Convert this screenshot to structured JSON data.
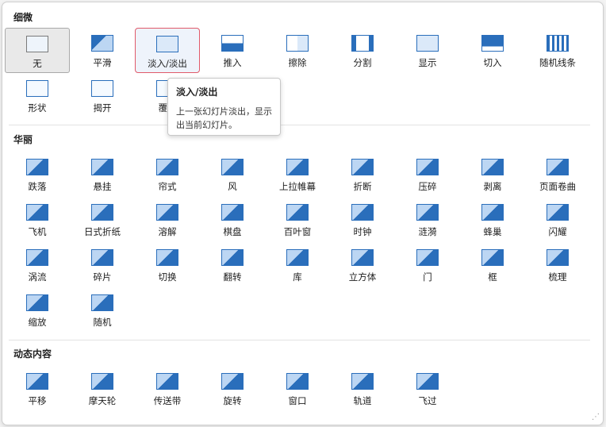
{
  "sections": [
    {
      "title": "细微",
      "items": [
        {
          "label": "无",
          "icon": "none-icon"
        },
        {
          "label": "平滑",
          "icon": "smooth-icon"
        },
        {
          "label": "淡入/淡出",
          "icon": "fade-icon"
        },
        {
          "label": "推入",
          "icon": "push-icon"
        },
        {
          "label": "擦除",
          "icon": "wipe-icon"
        },
        {
          "label": "分割",
          "icon": "split-icon"
        },
        {
          "label": "显示",
          "icon": "reveal-icon"
        },
        {
          "label": "切入",
          "icon": "cut-icon"
        },
        {
          "label": "随机线条",
          "icon": "random-bars-icon"
        },
        {
          "label": "形状",
          "icon": "shape-icon"
        },
        {
          "label": "揭开",
          "icon": "uncover-icon"
        },
        {
          "label": "覆盖",
          "icon": "cover-icon"
        }
      ]
    },
    {
      "title": "华丽",
      "items": [
        {
          "label": "跌落",
          "icon": "fall-over-icon"
        },
        {
          "label": "悬挂",
          "icon": "drape-icon"
        },
        {
          "label": "帘式",
          "icon": "curtains-icon"
        },
        {
          "label": "风",
          "icon": "wind-icon"
        },
        {
          "label": "上拉帷幕",
          "icon": "prestige-icon"
        },
        {
          "label": "折断",
          "icon": "fracture-icon"
        },
        {
          "label": "压碎",
          "icon": "crush-icon"
        },
        {
          "label": "剥离",
          "icon": "peel-off-icon"
        },
        {
          "label": "页面卷曲",
          "icon": "page-curl-icon"
        },
        {
          "label": "飞机",
          "icon": "airplane-icon"
        },
        {
          "label": "日式折纸",
          "icon": "origami-icon"
        },
        {
          "label": "溶解",
          "icon": "dissolve-icon"
        },
        {
          "label": "棋盘",
          "icon": "checkerboard-icon"
        },
        {
          "label": "百叶窗",
          "icon": "blinds-icon"
        },
        {
          "label": "时钟",
          "icon": "clock-icon"
        },
        {
          "label": "涟漪",
          "icon": "ripple-icon"
        },
        {
          "label": "蜂巢",
          "icon": "honeycomb-icon"
        },
        {
          "label": "闪耀",
          "icon": "glitter-icon"
        },
        {
          "label": "涡流",
          "icon": "vortex-icon"
        },
        {
          "label": "碎片",
          "icon": "shred-icon"
        },
        {
          "label": "切换",
          "icon": "switch-icon"
        },
        {
          "label": "翻转",
          "icon": "flip-icon"
        },
        {
          "label": "库",
          "icon": "gallery-icon"
        },
        {
          "label": "立方体",
          "icon": "cube-icon"
        },
        {
          "label": "门",
          "icon": "doors-icon"
        },
        {
          "label": "框",
          "icon": "box-icon"
        },
        {
          "label": "梳理",
          "icon": "comb-icon"
        },
        {
          "label": "缩放",
          "icon": "zoom-icon"
        },
        {
          "label": "随机",
          "icon": "random-icon"
        }
      ]
    },
    {
      "title": "动态内容",
      "items": [
        {
          "label": "平移",
          "icon": "pan-icon"
        },
        {
          "label": "摩天轮",
          "icon": "ferris-wheel-icon"
        },
        {
          "label": "传送带",
          "icon": "conveyor-icon"
        },
        {
          "label": "旋转",
          "icon": "rotate-icon"
        },
        {
          "label": "窗口",
          "icon": "window-icon"
        },
        {
          "label": "轨道",
          "icon": "orbit-icon"
        },
        {
          "label": "飞过",
          "icon": "fly-through-icon"
        }
      ]
    }
  ],
  "tooltip": {
    "title": "淡入/淡出",
    "body": "上一张幻灯片淡出，显示出当前幻灯片。"
  },
  "colors": {
    "accent": "#2a6ebb",
    "hover_border": "#e05a6a"
  }
}
